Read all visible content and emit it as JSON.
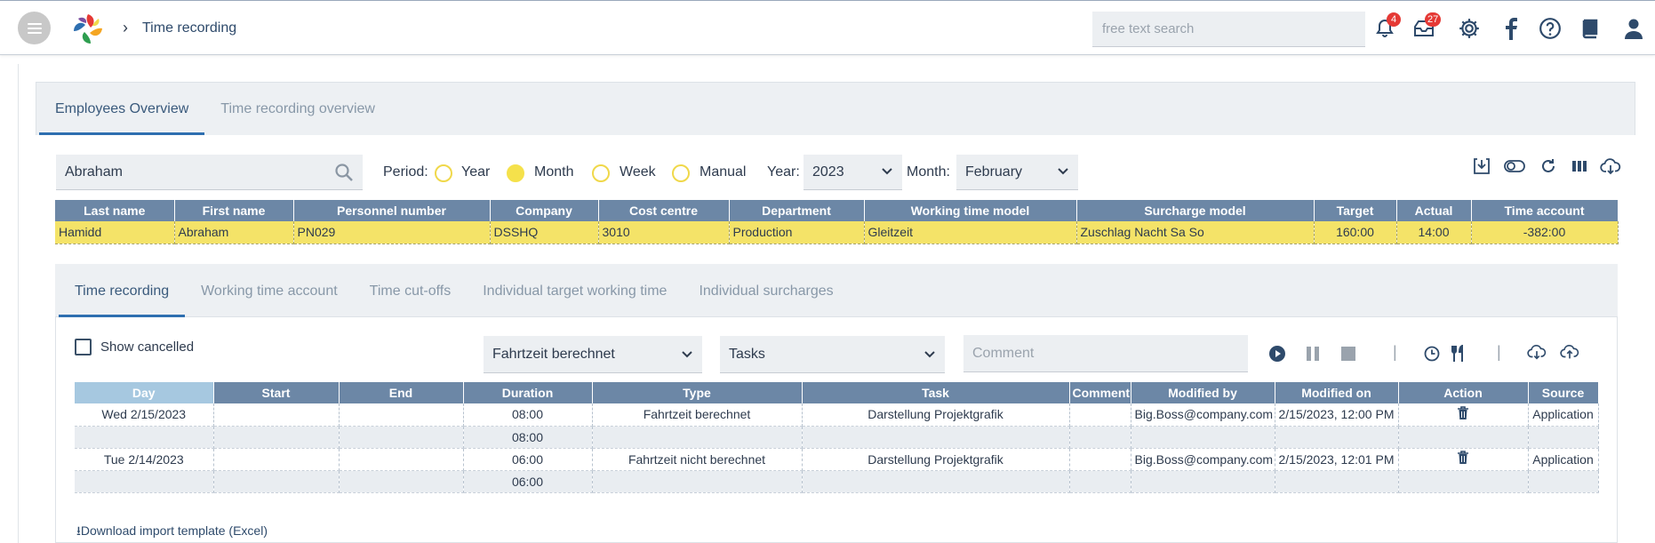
{
  "header": {
    "breadcrumb_title": "Time recording",
    "search_placeholder": "free text search",
    "notifications_count": "4",
    "messages_count": "27"
  },
  "main_tabs": [
    {
      "label": "Employees Overview",
      "active": true
    },
    {
      "label": "Time recording overview",
      "active": false
    }
  ],
  "filters": {
    "name_search_value": "Abraham",
    "period_label": "Period:",
    "period_options": [
      "Year",
      "Month",
      "Week",
      "Manual"
    ],
    "period_selected": "Month",
    "year_label": "Year:",
    "year_value": "2023",
    "month_label": "Month:",
    "month_value": "February"
  },
  "employees_table": {
    "columns": [
      "Last name",
      "First name",
      "Personnel number",
      "Company",
      "Cost centre",
      "Department",
      "Working time model",
      "Surcharge model",
      "Target",
      "Actual",
      "Time account"
    ],
    "rows": [
      [
        "Hamidd",
        "Abraham",
        "PN029",
        "DSSHQ",
        "3010",
        "Production",
        "Gleitzeit",
        "Zuschlag Nacht Sa So",
        "160:00",
        "14:00",
        "-382:00"
      ]
    ]
  },
  "sub_tabs": [
    {
      "label": "Time recording",
      "active": true
    },
    {
      "label": "Working time account",
      "active": false
    },
    {
      "label": "Time cut-offs",
      "active": false
    },
    {
      "label": "Individual target working time",
      "active": false
    },
    {
      "label": "Individual surcharges",
      "active": false
    }
  ],
  "recording": {
    "show_cancelled_label": "Show cancelled",
    "type_value": "Fahrtzeit berechnet",
    "tasks_value": "Tasks",
    "comment_placeholder": "Comment"
  },
  "time_table": {
    "columns": [
      "Day",
      "Start",
      "End",
      "Duration",
      "Type",
      "Task",
      "Comment",
      "Modified by",
      "Modified on",
      "Action",
      "Source"
    ],
    "rows": [
      {
        "day": "Wed 2/15/2023",
        "start": "",
        "end": "",
        "duration": "08:00",
        "type": "Fahrtzeit berechnet",
        "task": "Darstellung Projektgrafik",
        "comment": "",
        "modified_by": "Big.Boss@company.com",
        "modified_on": "2/15/2023, 12:00 PM",
        "source": "Application",
        "subtotal": "08:00"
      },
      {
        "day": "Tue 2/14/2023",
        "start": "",
        "end": "",
        "duration": "06:00",
        "type": "Fahrtzeit nicht berechnet",
        "task": "Darstellung Projektgrafik",
        "comment": "",
        "modified_by": "Big.Boss@company.com",
        "modified_on": "2/15/2023, 12:01 PM",
        "source": "Application",
        "subtotal": "06:00"
      }
    ]
  },
  "download_label": "Download import template (Excel)",
  "colors": {
    "accent": "#2e6fb0",
    "table_header": "#6c87a6",
    "selected_row": "#f4e368",
    "badge": "#e53935"
  }
}
